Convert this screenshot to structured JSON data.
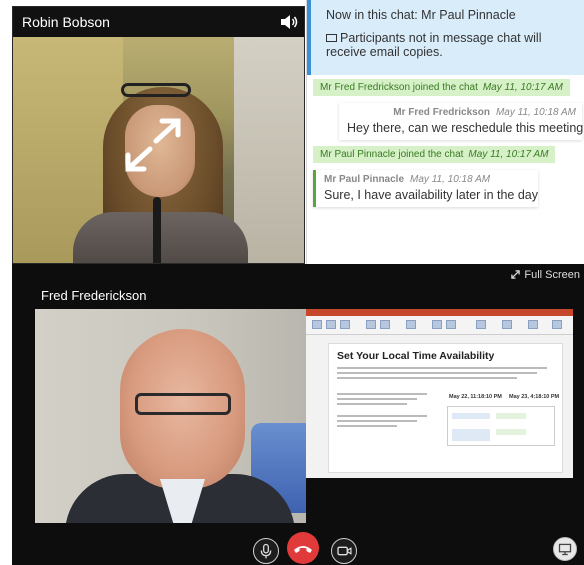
{
  "top_tile": {
    "name": "Robin Bobson",
    "speaker_icon": "speaker-icon",
    "expand_icon": "expand-icon"
  },
  "chat": {
    "info_line1": "Now in this chat: Mr Paul Pinnacle",
    "info_line2": "Participants not in message chat will receive email copies.",
    "events": [
      {
        "text": "Mr Fred Fredrickson joined the chat",
        "time": "May 11, 10:17 AM"
      },
      {
        "text": "Mr Paul Pinnacle joined the chat",
        "time": "May 11, 10:17 AM"
      }
    ],
    "messages": [
      {
        "author": "Mr Fred Fredrickson",
        "time": "May 11, 10:18 AM",
        "text": "Hey there, can we reschedule this meeting?"
      },
      {
        "author": "Mr Paul Pinnacle",
        "time": "May 11, 10:18 AM",
        "text": "Sure, I have availability later in the day"
      }
    ],
    "colors": {
      "info_bg": "#d9ecfa",
      "system_bg": "#d6f0c8",
      "system_text": "#3a7b22"
    }
  },
  "stage": {
    "name": "Fred Frederickson",
    "fullscreen_label": "Full Screen"
  },
  "slide": {
    "title": "Set Your Local Time Availability",
    "time_left": "May 22, 11:18:10 PM",
    "time_right": "May 23, 4:18:10 PM"
  },
  "controls": {
    "mic_icon": "microphone-icon",
    "hangup_icon": "phone-hangup-icon",
    "camera_icon": "video-camera-icon",
    "screen_icon": "screen-share-icon",
    "hangup_color": "#e13a3a"
  }
}
